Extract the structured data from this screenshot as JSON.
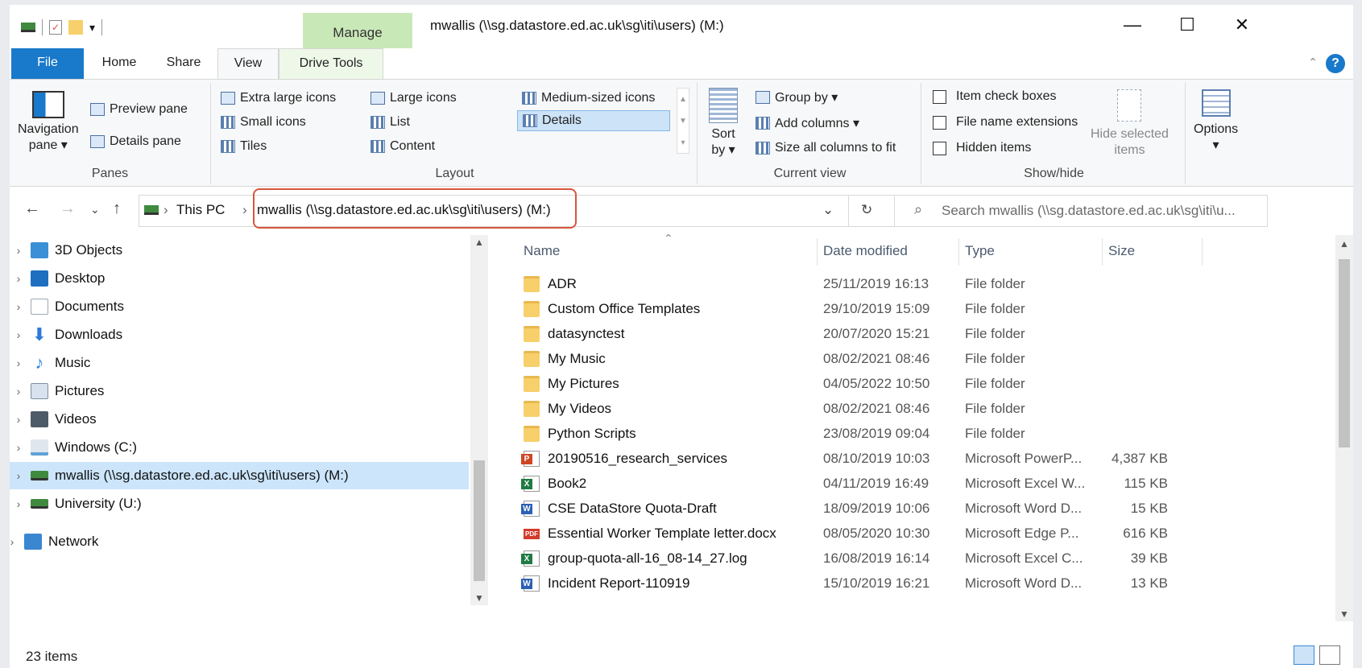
{
  "window": {
    "title": "mwallis (\\\\sg.datastore.ed.ac.uk\\sg\\iti\\users) (M:)",
    "controls": {
      "minimize": "—",
      "maximize": "☐",
      "close": "✕"
    }
  },
  "qat": {
    "dropdown": "▾"
  },
  "ribbon_tabs": {
    "file": "File",
    "home": "Home",
    "share": "Share",
    "view": "View",
    "manage": "Manage",
    "drive_tools": "Drive Tools"
  },
  "ribbon": {
    "panes": {
      "navigation_pane": "Navigation\npane ▾",
      "preview_pane": "Preview pane",
      "details_pane": "Details pane",
      "label": "Panes"
    },
    "layout": {
      "extra_large_icons": "Extra large icons",
      "large_icons": "Large icons",
      "medium_icons": "Medium-sized icons",
      "small_icons": "Small icons",
      "list": "List",
      "details": "Details",
      "tiles": "Tiles",
      "content": "Content",
      "label": "Layout"
    },
    "current_view": {
      "sort_by": "Sort\nby ▾",
      "group_by": "Group by ▾",
      "add_columns": "Add columns ▾",
      "size_columns": "Size all columns to fit",
      "label": "Current view"
    },
    "show_hide": {
      "item_check_boxes": "Item check boxes",
      "file_name_extensions": "File name extensions",
      "hidden_items": "Hidden items",
      "hide_selected": "Hide selected\nitems",
      "label": "Show/hide"
    },
    "options": "Options\n▾"
  },
  "address": {
    "this_pc": "This PC",
    "current": "mwallis (\\\\sg.datastore.ed.ac.uk\\sg\\iti\\users) (M:)",
    "search_placeholder": "Search mwallis (\\\\sg.datastore.ed.ac.uk\\sg\\iti\\u..."
  },
  "nav_items": [
    {
      "label": "3D Objects",
      "color": "#3a8fd6"
    },
    {
      "label": "Desktop",
      "color": "#1e6fbf"
    },
    {
      "label": "Documents",
      "color": "#9aa7b5"
    },
    {
      "label": "Downloads",
      "color": "#2d7ad6"
    },
    {
      "label": "Music",
      "color": "#2f86d8"
    },
    {
      "label": "Pictures",
      "color": "#7d8fa3"
    },
    {
      "label": "Videos",
      "color": "#4d5a68"
    },
    {
      "label": "Windows (C:)",
      "color": "#5fa2d8"
    },
    {
      "label": "mwallis (\\\\sg.datastore.ed.ac.uk\\sg\\iti\\users) (M:)",
      "color": "#3f8a3f"
    },
    {
      "label": "University (U:)",
      "color": "#3f8a3f"
    },
    {
      "label": "Network",
      "color": "#3a86d0"
    }
  ],
  "columns": {
    "name": "Name",
    "date": "Date modified",
    "type": "Type",
    "size": "Size"
  },
  "files": [
    {
      "name": "ADR",
      "date": "25/11/2019 16:13",
      "type": "File folder",
      "size": "",
      "kind": "folder"
    },
    {
      "name": "Custom Office Templates",
      "date": "29/10/2019 15:09",
      "type": "File folder",
      "size": "",
      "kind": "folder"
    },
    {
      "name": "datasynctest",
      "date": "20/07/2020 15:21",
      "type": "File folder",
      "size": "",
      "kind": "folder"
    },
    {
      "name": "My Music",
      "date": "08/02/2021 08:46",
      "type": "File folder",
      "size": "",
      "kind": "folder"
    },
    {
      "name": "My Pictures",
      "date": "04/05/2022 10:50",
      "type": "File folder",
      "size": "",
      "kind": "folder"
    },
    {
      "name": "My Videos",
      "date": "08/02/2021 08:46",
      "type": "File folder",
      "size": "",
      "kind": "folder"
    },
    {
      "name": "Python Scripts",
      "date": "23/08/2019 09:04",
      "type": "File folder",
      "size": "",
      "kind": "folder"
    },
    {
      "name": "20190516_research_services",
      "date": "08/10/2019 10:03",
      "type": "Microsoft PowerP...",
      "size": "4,387 KB",
      "kind": "ppt"
    },
    {
      "name": "Book2",
      "date": "04/11/2019 16:49",
      "type": "Microsoft Excel W...",
      "size": "115 KB",
      "kind": "xls"
    },
    {
      "name": "CSE DataStore Quota-Draft",
      "date": "18/09/2019 10:06",
      "type": "Microsoft Word D...",
      "size": "15 KB",
      "kind": "doc"
    },
    {
      "name": "Essential Worker Template letter.docx",
      "date": "08/05/2020 10:30",
      "type": "Microsoft Edge P...",
      "size": "616 KB",
      "kind": "pdf"
    },
    {
      "name": "group-quota-all-16_08-14_27.log",
      "date": "16/08/2019 16:14",
      "type": "Microsoft Excel C...",
      "size": "39 KB",
      "kind": "xls"
    },
    {
      "name": "Incident Report-110919",
      "date": "15/10/2019 16:21",
      "type": "Microsoft Word D...",
      "size": "13 KB",
      "kind": "doc"
    }
  ],
  "status": {
    "items": "23 items"
  },
  "colors": {
    "accent": "#1979ca",
    "manage_tab": "#c9e8b8",
    "highlight": "#d9553d",
    "selection": "#cce5fb"
  }
}
